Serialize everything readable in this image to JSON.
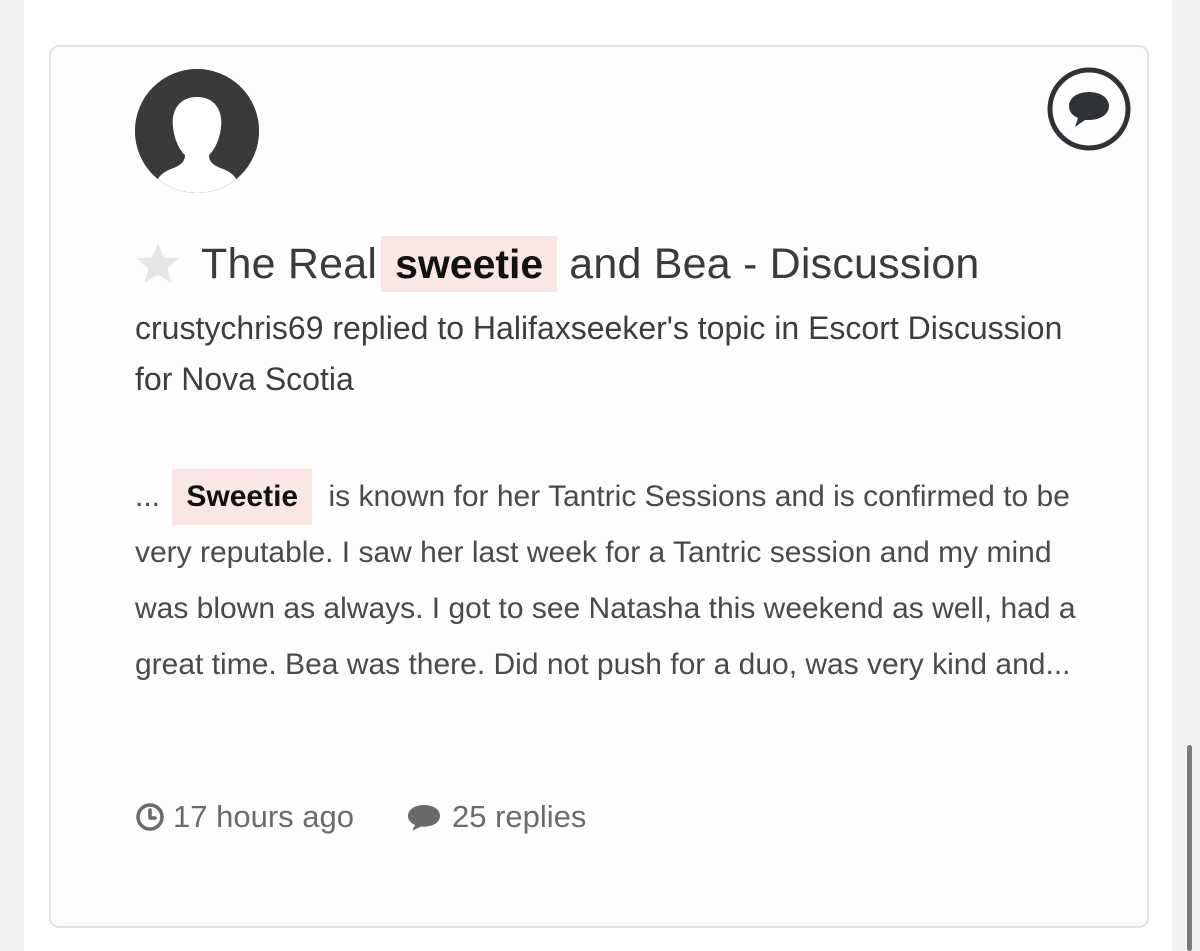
{
  "post": {
    "title_before": "The Real",
    "title_highlight": "sweetie",
    "title_after": "and Bea - Discussion",
    "meta": "crustychris69 replied to Halifaxseeker's topic in Escort Discussion for Nova Scotia",
    "excerpt_prefix": "...",
    "excerpt_highlight": "Sweetie",
    "excerpt_rest": "is known for her Tantric Sessions and is confirmed to be very reputable. I saw her last week for a Tantric session and my mind was blown as always. I got to see Natasha this weekend as well, had a great time. Bea was there. Did not push for a duo, was very kind and...",
    "time_ago": "17 hours ago",
    "replies": "25 replies"
  },
  "icons": {
    "avatar": "default-user-avatar",
    "type_badge": "comment-bubble-icon",
    "follow": "star-icon",
    "time": "clock-icon",
    "replies": "speech-bubble-icon"
  },
  "colors": {
    "highlight_bg": "#fbe6e6",
    "text_primary": "#3b3b3b",
    "text_muted": "#6b6b6b",
    "star": "#e6e6e6",
    "badge_stroke": "#2f3338"
  }
}
